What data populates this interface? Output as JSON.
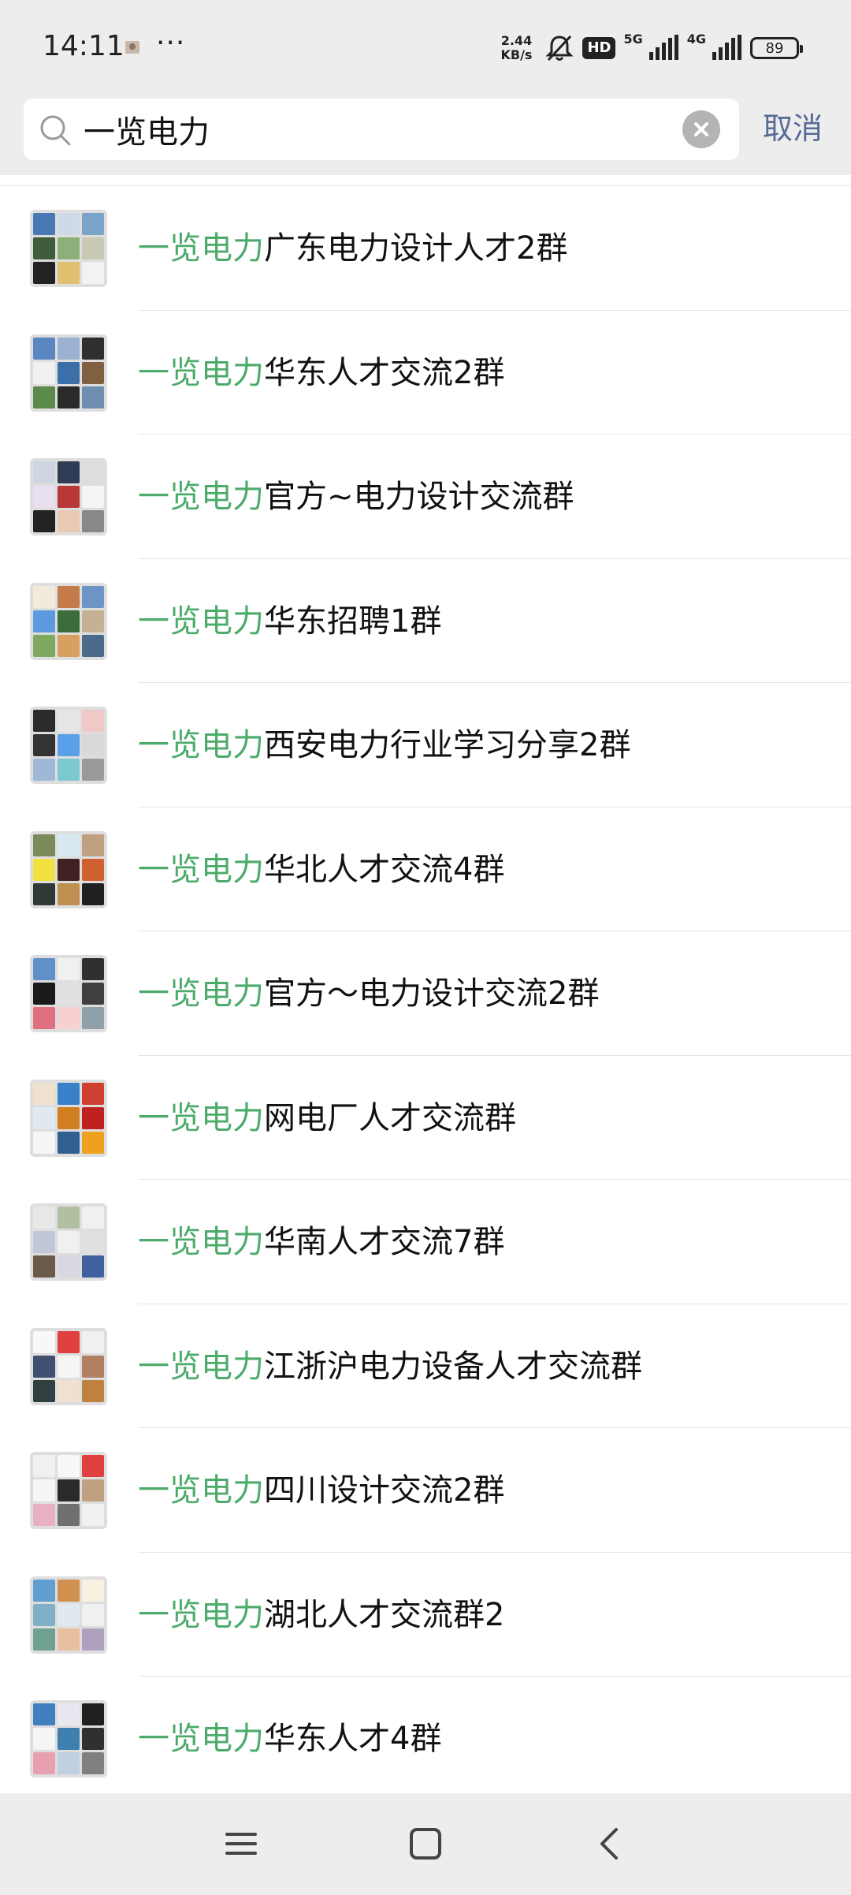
{
  "status_bar": {
    "time": "14:11",
    "more": "···",
    "net_speed_value": "2.44",
    "net_speed_unit": "KB/s",
    "hd_label": "HD",
    "signal_1_label": "5G",
    "signal_2_label": "4G",
    "battery_level": "89",
    "icons": [
      "notification-thumbnail-icon",
      "mute-bell-icon",
      "signal-bars-icon",
      "battery-icon"
    ]
  },
  "search": {
    "query": "一览电力",
    "placeholder": "",
    "cancel_label": "取消"
  },
  "results": [
    {
      "highlight": "一览电力",
      "rest": "广东电力设计人才2群"
    },
    {
      "highlight": "一览电力",
      "rest": "华东人才交流2群"
    },
    {
      "highlight": "一览电力",
      "rest": "官方~电力设计交流群"
    },
    {
      "highlight": "一览电力",
      "rest": "华东招聘1群"
    },
    {
      "highlight": "一览电力",
      "rest": "西安电力行业学习分享2群"
    },
    {
      "highlight": "一览电力",
      "rest": "华北人才交流4群"
    },
    {
      "highlight": "一览电力",
      "rest": "官方～电力设计交流2群"
    },
    {
      "highlight": "一览电力",
      "rest": "网电厂人才交流群"
    },
    {
      "highlight": "一览电力",
      "rest": "华南人才交流7群"
    },
    {
      "highlight": "一览电力",
      "rest": "江浙沪电力设备人才交流群"
    },
    {
      "highlight": "一览电力",
      "rest": "四川设计交流2群"
    },
    {
      "highlight": "一览电力",
      "rest": "湖北人才交流群2"
    },
    {
      "highlight": "一览电力",
      "rest": "华东人才4群"
    }
  ],
  "nav": {
    "icons": [
      "menu-icon",
      "home-icon",
      "back-icon"
    ]
  },
  "colors": {
    "highlight": "#4cab6b",
    "link": "#576b95",
    "background": "#ededed"
  }
}
